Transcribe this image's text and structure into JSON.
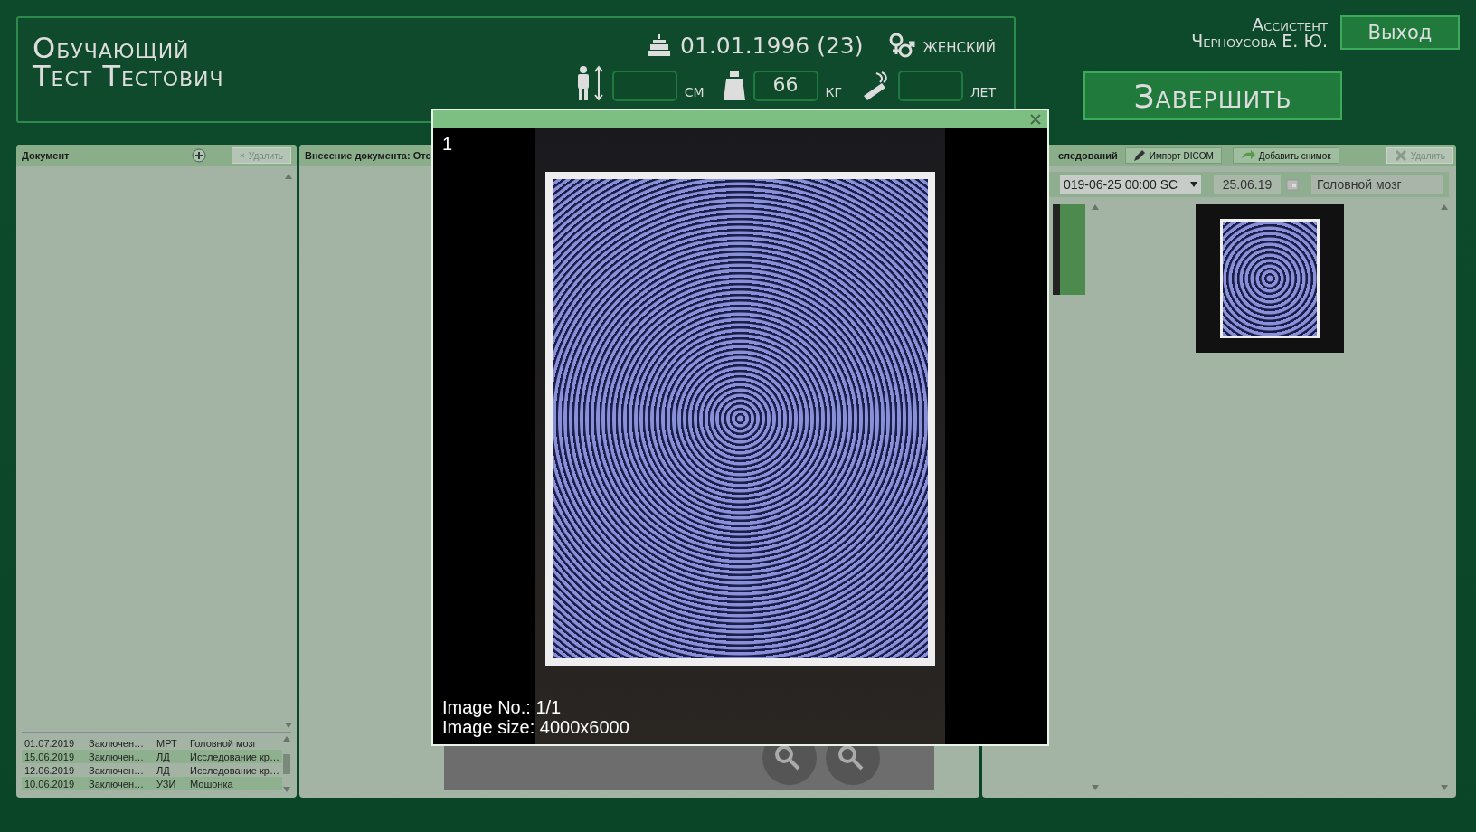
{
  "patient": {
    "name_lines": [
      "Обучающий",
      "Тест Тестович"
    ],
    "birth": "01.01.1996 (23)",
    "sex": "женский",
    "measures": [
      {
        "kind": "height",
        "unit": "см"
      },
      {
        "kind": "weight",
        "value": "66",
        "unit": "кг"
      },
      {
        "kind": "smoking",
        "unit": "лет"
      }
    ]
  },
  "user": {
    "role": "Ассистент",
    "name": "Черноусова Е. Ю."
  },
  "exit_button": "Выход",
  "finish_button": "Завершить",
  "documents_panel": {
    "title": "Документ",
    "delete_button": {
      "label": "Удалить",
      "disabled": true
    },
    "rows": [
      {
        "date": "01.07.2019",
        "type": "Заключен…",
        "method": "МРТ",
        "area": "Головной мозг"
      },
      {
        "date": "15.06.2019",
        "type": "Заключен…",
        "method": "ЛД",
        "area": "Исследование кр…"
      },
      {
        "date": "12.06.2019",
        "type": "Заключен…",
        "method": "ЛД",
        "area": "Исследование кр…"
      },
      {
        "date": "10.06.2019",
        "type": "Заключен…",
        "method": "УЗИ",
        "area": "Мошонка"
      }
    ]
  },
  "entry_panel": {
    "title": "Внесение документа: Отс"
  },
  "studies_panel": {
    "title": "следований",
    "buttons": [
      {
        "kind": "import",
        "label": "Импорт DICOM",
        "disabled": false
      },
      {
        "kind": "add",
        "label": "Добавить снимок",
        "disabled": false
      },
      {
        "kind": "delete",
        "label": "Удалить",
        "disabled": true
      }
    ],
    "series_select": "019-06-25 00:00 SC",
    "date": "25.06.19",
    "area": "Головной мозг"
  },
  "viewer": {
    "index": "1",
    "image_no": "Image No.: 1/1",
    "image_size": "Image size: 4000x6000"
  }
}
